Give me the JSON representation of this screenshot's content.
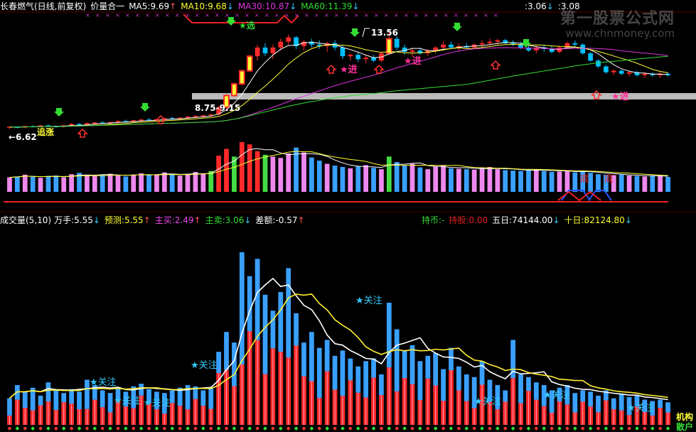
{
  "header": {
    "stock": "长春燃气(日线,前复权)",
    "mode": "价量合一",
    "ma5": "MA5:9.69",
    "ma10": "MA10:9.68",
    "ma30": "MA30:10.87",
    "ma60": "MA60:11.39",
    "r1": ":3.06",
    "r2": ":3.08",
    "ma5_arrow": "↑",
    "ma10_arrow": "↓",
    "ma30_arrow": "↓",
    "ma60_arrow": "↓"
  },
  "watermark": {
    "line1": "第一股票公式网",
    "line2": "www.chnmoney.com"
  },
  "vol_header": {
    "name": "成交量(5,10)",
    "unit": "万手:5.55",
    "forecast": "预测:5.55",
    "buy": "主买:2.49",
    "sell": "主卖:3.06",
    "diff": "差额:-0.57",
    "hold_coin": "持币:-",
    "hold_stock": "持股:0.00",
    "five": "五日:74144.00",
    "ten": "十日:82124.80",
    "arrow_down": "↓",
    "arrow_up": "↑"
  },
  "annotations": {
    "price_high": "13.56",
    "price_low": "6.62",
    "zone": "8.75-9.15",
    "chase": "追涨",
    "buy_in": "★进",
    "select": "★选",
    "bottom": "底",
    "watch": "★关注",
    "inst": "机构",
    "retail": "散户"
  },
  "colors": {
    "up": "#ff2a2a",
    "down": "#00bfff",
    "ma5": "#ffffff",
    "ma10": "#ffff33",
    "ma30": "#dd33dd",
    "ma60": "#33dd33",
    "vol_bull": "#ff4a8a",
    "vol_bear": "#3aa0ff",
    "vol_pink": "#ee88ee",
    "vol_green": "#44dd44",
    "watch": "#33ccff"
  },
  "chart_data": {
    "type": "candlestick",
    "price_range": [
      6.0,
      14.2
    ],
    "candles": [
      [
        6.9,
        7.0,
        6.8,
        6.95
      ],
      [
        6.95,
        7.0,
        6.85,
        6.9
      ],
      [
        6.9,
        7.05,
        6.85,
        7.0
      ],
      [
        7.0,
        7.05,
        6.9,
        6.95
      ],
      [
        6.95,
        7.1,
        6.9,
        7.05
      ],
      [
        7.05,
        7.1,
        6.95,
        7.0
      ],
      [
        7.0,
        7.05,
        6.9,
        6.95
      ],
      [
        6.95,
        7.1,
        6.9,
        7.05
      ],
      [
        7.05,
        7.2,
        7.0,
        7.15
      ],
      [
        7.15,
        7.2,
        7.05,
        7.1
      ],
      [
        7.1,
        7.25,
        7.05,
        7.2
      ],
      [
        7.2,
        7.3,
        7.1,
        7.25
      ],
      [
        7.25,
        7.35,
        7.15,
        7.2
      ],
      [
        7.2,
        7.3,
        7.1,
        7.28
      ],
      [
        7.28,
        7.4,
        7.2,
        7.35
      ],
      [
        7.35,
        7.45,
        7.25,
        7.3
      ],
      [
        7.3,
        7.45,
        7.25,
        7.4
      ],
      [
        7.4,
        7.5,
        7.3,
        7.45
      ],
      [
        7.45,
        7.55,
        7.35,
        7.4
      ],
      [
        7.4,
        7.5,
        7.3,
        7.48
      ],
      [
        7.48,
        7.6,
        7.4,
        7.55
      ],
      [
        7.55,
        7.65,
        7.45,
        7.5
      ],
      [
        7.5,
        7.6,
        7.4,
        7.58
      ],
      [
        7.58,
        7.7,
        7.5,
        7.65
      ],
      [
        7.65,
        7.75,
        7.55,
        7.7
      ],
      [
        7.7,
        7.8,
        7.6,
        7.75
      ],
      [
        7.75,
        7.85,
        7.65,
        7.8
      ],
      [
        7.8,
        8.4,
        7.75,
        8.3
      ],
      [
        8.3,
        9.2,
        8.2,
        9.1
      ],
      [
        9.1,
        10.0,
        9.0,
        9.9
      ],
      [
        9.9,
        10.9,
        9.8,
        10.8
      ],
      [
        10.8,
        11.9,
        10.7,
        11.8
      ],
      [
        11.8,
        12.6,
        11.5,
        12.4
      ],
      [
        12.4,
        12.7,
        11.8,
        12.0
      ],
      [
        12.0,
        12.6,
        11.6,
        12.4
      ],
      [
        12.4,
        13.0,
        12.2,
        12.8
      ],
      [
        12.8,
        13.3,
        12.6,
        13.1
      ],
      [
        13.1,
        13.2,
        12.3,
        12.5
      ],
      [
        12.5,
        12.9,
        12.2,
        12.8
      ],
      [
        12.8,
        13.0,
        12.4,
        12.6
      ],
      [
        12.6,
        12.9,
        12.3,
        12.5
      ],
      [
        12.5,
        12.8,
        12.1,
        12.7
      ],
      [
        12.7,
        12.9,
        12.2,
        12.4
      ],
      [
        12.4,
        12.6,
        11.6,
        11.8
      ],
      [
        11.8,
        12.0,
        11.5,
        11.9
      ],
      [
        11.9,
        12.1,
        11.4,
        11.6
      ],
      [
        11.6,
        11.9,
        11.3,
        11.7
      ],
      [
        11.7,
        11.9,
        11.4,
        11.5
      ],
      [
        11.5,
        12.1,
        11.4,
        12.0
      ],
      [
        12.0,
        13.56,
        11.9,
        13.0
      ],
      [
        13.0,
        13.2,
        12.2,
        12.4
      ],
      [
        12.4,
        12.6,
        11.9,
        12.1
      ],
      [
        12.1,
        12.4,
        11.8,
        12.2
      ],
      [
        12.2,
        12.4,
        11.9,
        12.0
      ],
      [
        12.0,
        12.3,
        11.8,
        12.2
      ],
      [
        12.2,
        12.5,
        12.0,
        12.4
      ],
      [
        12.4,
        12.8,
        12.2,
        12.6
      ],
      [
        12.6,
        12.8,
        12.3,
        12.4
      ],
      [
        12.4,
        12.7,
        12.2,
        12.5
      ],
      [
        12.5,
        12.7,
        12.3,
        12.4
      ],
      [
        12.4,
        12.7,
        12.3,
        12.6
      ],
      [
        12.6,
        12.9,
        12.4,
        12.7
      ],
      [
        12.7,
        13.0,
        12.5,
        12.8
      ],
      [
        12.8,
        13.0,
        12.6,
        12.9
      ],
      [
        12.9,
        13.0,
        12.6,
        12.7
      ],
      [
        12.7,
        12.9,
        12.5,
        12.6
      ],
      [
        12.6,
        12.8,
        12.3,
        12.4
      ],
      [
        12.4,
        12.6,
        12.1,
        12.2
      ],
      [
        12.2,
        12.5,
        12.0,
        12.4
      ],
      [
        12.4,
        12.6,
        12.1,
        12.3
      ],
      [
        12.3,
        12.5,
        12.0,
        12.1
      ],
      [
        12.1,
        12.5,
        12.0,
        12.4
      ],
      [
        12.4,
        12.8,
        12.3,
        12.7
      ],
      [
        12.7,
        12.9,
        12.4,
        12.6
      ],
      [
        12.6,
        12.7,
        11.9,
        12.0
      ],
      [
        12.0,
        12.1,
        11.4,
        11.5
      ],
      [
        11.5,
        11.6,
        11.0,
        11.1
      ],
      [
        11.1,
        11.2,
        10.6,
        10.7
      ],
      [
        10.7,
        10.9,
        10.5,
        10.8
      ],
      [
        10.8,
        10.9,
        10.5,
        10.6
      ],
      [
        10.6,
        10.8,
        10.4,
        10.7
      ],
      [
        10.7,
        10.8,
        10.4,
        10.5
      ],
      [
        10.5,
        10.7,
        10.3,
        10.6
      ],
      [
        10.6,
        10.7,
        10.4,
        10.5
      ],
      [
        10.5,
        10.7,
        10.3,
        10.6
      ],
      [
        10.6,
        10.7,
        10.4,
        10.5
      ]
    ],
    "volume": [
      3.2,
      3.4,
      3.8,
      3.3,
      3.1,
      3.5,
      3.6,
      3.2,
      3.9,
      4.2,
      3.7,
      3.5,
      3.8,
      4.0,
      3.6,
      3.4,
      3.8,
      4.1,
      3.7,
      3.9,
      4.3,
      3.8,
      3.6,
      4.0,
      4.4,
      4.1,
      4.6,
      8.0,
      9.5,
      7.8,
      11.0,
      10.5,
      9.0,
      8.2,
      7.8,
      7.5,
      8.5,
      9.8,
      8.7,
      7.6,
      6.9,
      6.2,
      5.8,
      5.5,
      5.2,
      5.6,
      5.9,
      5.3,
      5.0,
      7.8,
      6.6,
      5.9,
      6.2,
      5.4,
      5.0,
      5.6,
      5.8,
      5.2,
      5.1,
      5.0,
      4.9,
      5.3,
      5.5,
      5.0,
      4.8,
      4.7,
      4.6,
      4.9,
      5.0,
      4.6,
      4.4,
      4.5,
      4.7,
      4.3,
      4.6,
      4.2,
      3.9,
      3.8,
      3.7,
      3.8,
      3.6,
      3.5,
      3.4,
      3.6,
      3.5,
      3.3
    ],
    "lower_volume": [
      2.0,
      3.0,
      2.5,
      2.8,
      2.2,
      3.2,
      2.6,
      2.4,
      2.7,
      2.5,
      3.4,
      3.0,
      2.6,
      2.4,
      2.8,
      2.5,
      2.9,
      3.1,
      2.7,
      2.5,
      2.4,
      2.6,
      2.8,
      3.0,
      2.9,
      2.6,
      2.8,
      5.5,
      7.0,
      6.2,
      13.0,
      11.2,
      12.5,
      9.8,
      8.6,
      10.0,
      11.8,
      8.4,
      6.2,
      7.0,
      5.8,
      6.4,
      5.2,
      5.6,
      5.0,
      4.4,
      4.8,
      5.0,
      3.8,
      9.2,
      7.2,
      5.6,
      6.0,
      4.8,
      5.2,
      5.4,
      4.2,
      5.8,
      4.4,
      3.8,
      3.6,
      4.8,
      3.4,
      3.0,
      2.6,
      6.4,
      3.8,
      3.6,
      3.2,
      3.0,
      2.6,
      2.8,
      3.0,
      2.4,
      2.6,
      2.5,
      2.2,
      2.6,
      2.0,
      2.3,
      2.1,
      2.2,
      1.9,
      1.8,
      1.9,
      1.7
    ]
  }
}
